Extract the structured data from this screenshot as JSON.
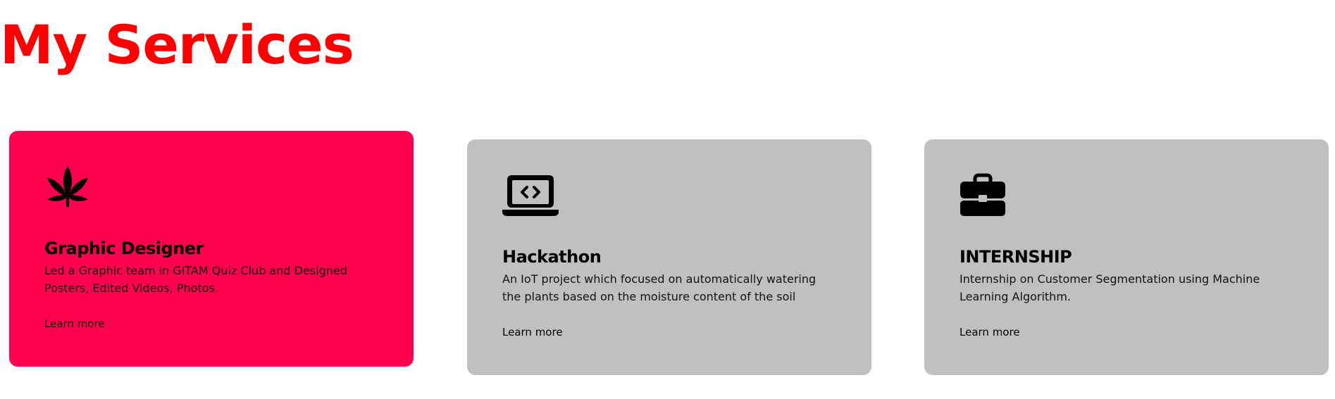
{
  "section": {
    "title": "My Services",
    "title_color": "#ff0000"
  },
  "services": [
    {
      "icon": "cannabis-leaf-icon",
      "title": "Graphic Designer",
      "description": "Led a Graphic team in GITAM Quiz Club and Designed Posters, Edited Videos, Photos.",
      "link_label": "Learn more",
      "background": "#ff004f"
    },
    {
      "icon": "laptop-code-icon",
      "title": "Hackathon",
      "description": "An IoT project which focused on automatically watering the plants based on the moisture content of the soil",
      "link_label": "Learn more",
      "background": "#c0c0c0"
    },
    {
      "icon": "briefcase-icon",
      "title": "INTERNSHIP",
      "description": "Internship on Customer Segmentation using Machine Learning Algorithm.",
      "link_label": "Learn more",
      "background": "#c0c0c0"
    }
  ]
}
